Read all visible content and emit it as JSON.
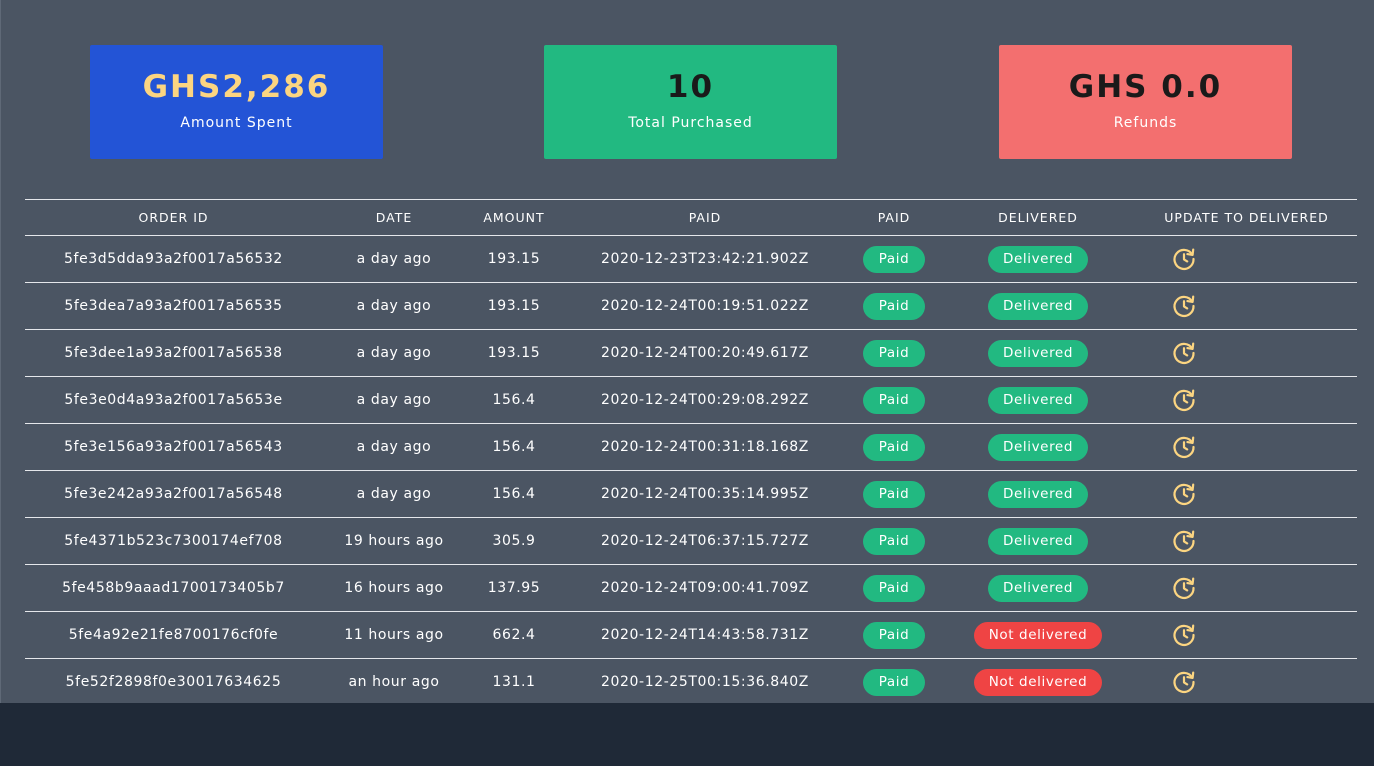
{
  "summary": {
    "amount_spent": {
      "value": "GHS2,286",
      "label": "Amount Spent"
    },
    "total_purchased": {
      "value": "10",
      "label": "Total Purchased"
    },
    "refunds": {
      "value": "GHS 0.0",
      "label": "Refunds"
    }
  },
  "table": {
    "headers": [
      "ORDER ID",
      "DATE",
      "AMOUNT",
      "PAID",
      "PAID",
      "DELIVERED",
      "UPDATE TO DELIVERED"
    ],
    "rows": [
      {
        "order_id": "5fe3d5dda93a2f0017a56532",
        "date": "a day ago",
        "amount": "193.15",
        "paid_at": "2020-12-23T23:42:21.902Z",
        "paid_status": "Paid",
        "delivered_status": "Delivered",
        "delivered": true
      },
      {
        "order_id": "5fe3dea7a93a2f0017a56535",
        "date": "a day ago",
        "amount": "193.15",
        "paid_at": "2020-12-24T00:19:51.022Z",
        "paid_status": "Paid",
        "delivered_status": "Delivered",
        "delivered": true
      },
      {
        "order_id": "5fe3dee1a93a2f0017a56538",
        "date": "a day ago",
        "amount": "193.15",
        "paid_at": "2020-12-24T00:20:49.617Z",
        "paid_status": "Paid",
        "delivered_status": "Delivered",
        "delivered": true
      },
      {
        "order_id": "5fe3e0d4a93a2f0017a5653e",
        "date": "a day ago",
        "amount": "156.4",
        "paid_at": "2020-12-24T00:29:08.292Z",
        "paid_status": "Paid",
        "delivered_status": "Delivered",
        "delivered": true
      },
      {
        "order_id": "5fe3e156a93a2f0017a56543",
        "date": "a day ago",
        "amount": "156.4",
        "paid_at": "2020-12-24T00:31:18.168Z",
        "paid_status": "Paid",
        "delivered_status": "Delivered",
        "delivered": true
      },
      {
        "order_id": "5fe3e242a93a2f0017a56548",
        "date": "a day ago",
        "amount": "156.4",
        "paid_at": "2020-12-24T00:35:14.995Z",
        "paid_status": "Paid",
        "delivered_status": "Delivered",
        "delivered": true
      },
      {
        "order_id": "5fe4371b523c7300174ef708",
        "date": "19 hours ago",
        "amount": "305.9",
        "paid_at": "2020-12-24T06:37:15.727Z",
        "paid_status": "Paid",
        "delivered_status": "Delivered",
        "delivered": true
      },
      {
        "order_id": "5fe458b9aaad1700173405b7",
        "date": "16 hours ago",
        "amount": "137.95",
        "paid_at": "2020-12-24T09:00:41.709Z",
        "paid_status": "Paid",
        "delivered_status": "Delivered",
        "delivered": true
      },
      {
        "order_id": "5fe4a92e21fe8700176cf0fe",
        "date": "11 hours ago",
        "amount": "662.4",
        "paid_at": "2020-12-24T14:43:58.731Z",
        "paid_status": "Paid",
        "delivered_status": "Not delivered",
        "delivered": false
      },
      {
        "order_id": "5fe52f2898f0e30017634625",
        "date": "an hour ago",
        "amount": "131.1",
        "paid_at": "2020-12-25T00:15:36.840Z",
        "paid_status": "Paid",
        "delivered_status": "Not delivered",
        "delivered": false
      }
    ]
  },
  "icons": {
    "update": "refresh-clock-icon"
  },
  "colors": {
    "panel_bg": "#4b5563",
    "page_bg": "#1f2937",
    "card_spent": "#2354d6",
    "card_purchased": "#22b981",
    "card_refunds": "#f36f6f",
    "status_green": "#22b981",
    "status_red": "#ef4444",
    "icon_yellow": "#fcd581"
  }
}
